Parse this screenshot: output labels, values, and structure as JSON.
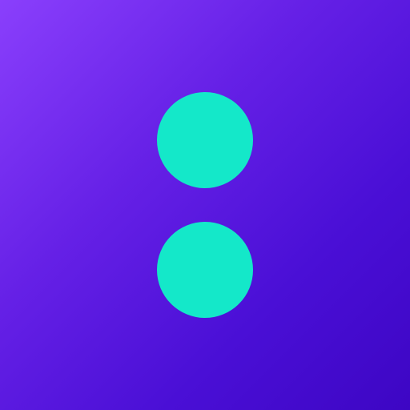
{
  "icon": {
    "name": "two-dots-logo",
    "background_colors": [
      "#8a3ffc",
      "#6520e6",
      "#4a0fd6",
      "#3d06c4"
    ],
    "dot_color": "#14e8c9",
    "dot_count": 2
  }
}
